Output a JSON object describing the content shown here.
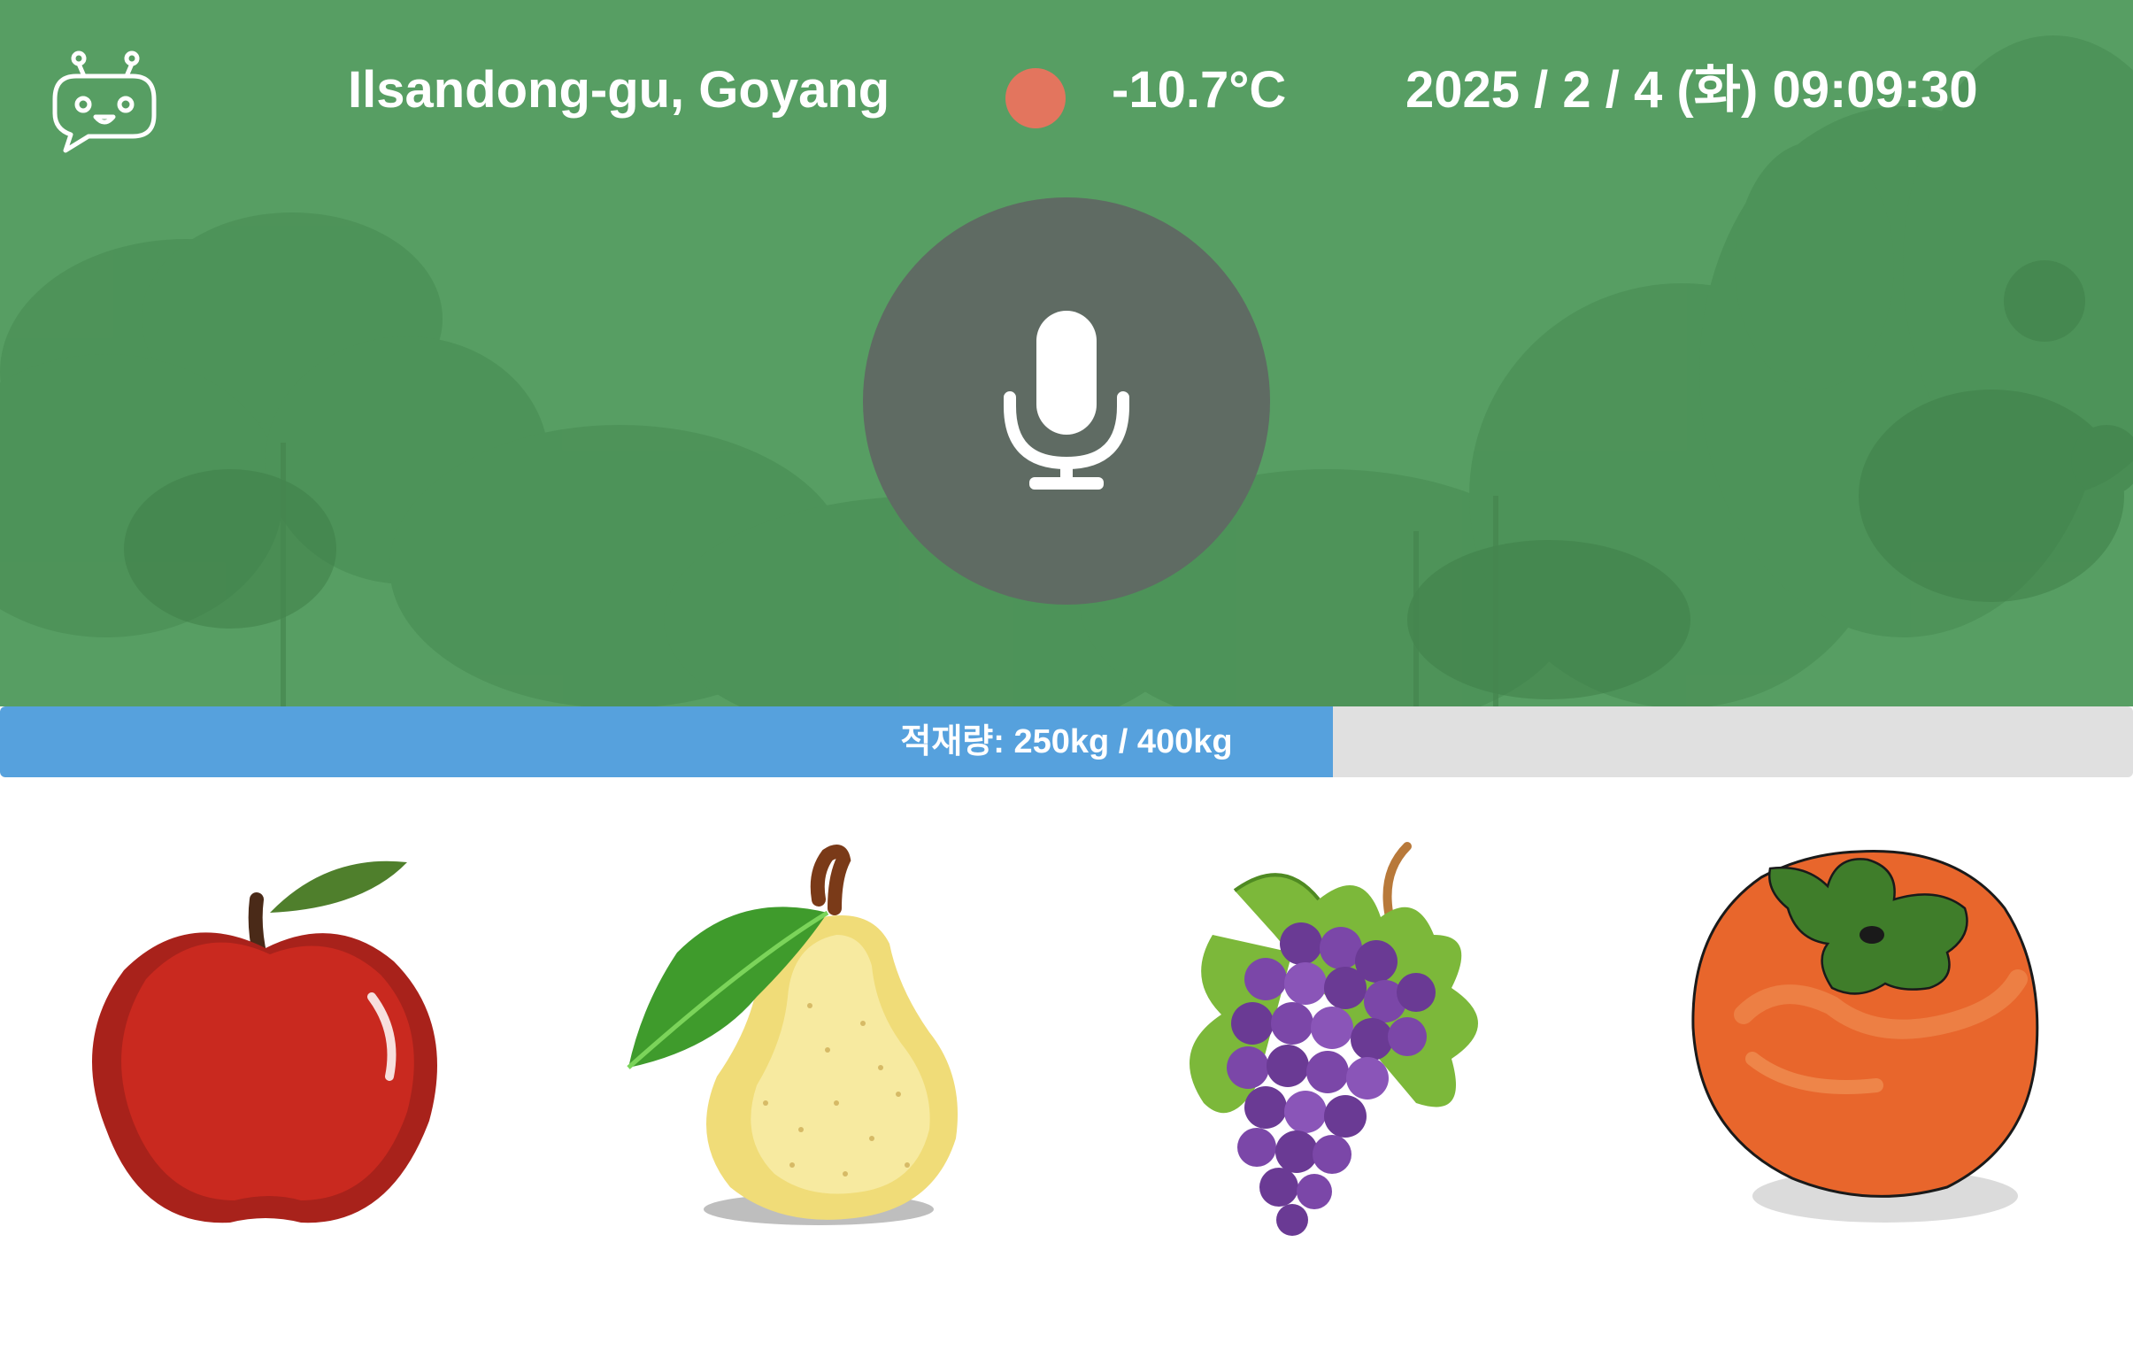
{
  "header": {
    "location": "Ilsandong-gu, Goyang",
    "temperature": "-10.7°C",
    "datetime": "2025 / 2 / 4 (화) 09:09:30",
    "weather_indicator_color": "#e3755e"
  },
  "assistant": {
    "icon": "robot-chat-icon"
  },
  "voice": {
    "icon": "microphone-icon"
  },
  "capacity": {
    "label": "적재량: 250kg / 400kg",
    "current_kg": 250,
    "max_kg": 400,
    "fill_fraction": 0.625,
    "fill_color": "#56a1dd"
  },
  "fruits": [
    {
      "name": "apple",
      "icon": "apple-icon"
    },
    {
      "name": "pear",
      "icon": "pear-icon"
    },
    {
      "name": "grapes",
      "icon": "grapes-icon"
    },
    {
      "name": "persimmon",
      "icon": "persimmon-icon"
    }
  ],
  "colors": {
    "hero_background": "#579e63",
    "mic_button": "#5f6b63"
  }
}
